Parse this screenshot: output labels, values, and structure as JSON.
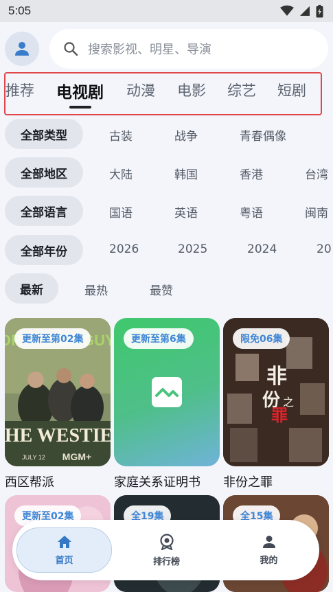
{
  "status_bar": {
    "time": "5:05"
  },
  "search": {
    "placeholder": "搜索影视、明星、导演"
  },
  "tabs": [
    {
      "label": "推荐"
    },
    {
      "label": "电视剧",
      "active": true
    },
    {
      "label": "动漫"
    },
    {
      "label": "电影"
    },
    {
      "label": "综艺"
    },
    {
      "label": "短剧"
    }
  ],
  "filters": {
    "type": {
      "label": "全部类型",
      "options": [
        "古装",
        "战争",
        "青春偶像"
      ]
    },
    "region": {
      "label": "全部地区",
      "options": [
        "大陆",
        "韩国",
        "香港",
        "台湾"
      ]
    },
    "language": {
      "label": "全部语言",
      "options": [
        "国语",
        "英语",
        "粤语",
        "闽南"
      ]
    },
    "year": {
      "label": "全部年份",
      "options": [
        "2026",
        "2025",
        "2024",
        "20"
      ]
    },
    "sort": {
      "label": "最新",
      "options": [
        "最热",
        "最赞"
      ]
    }
  },
  "cards": [
    {
      "badge": "更新至第02集",
      "title": "西区帮派",
      "poster_text": [
        "FOR THOSE GUYS",
        "THE WESTIES",
        "JULY 12",
        "MGM+"
      ]
    },
    {
      "badge": "更新至第6集",
      "title": "家庭关系证明书"
    },
    {
      "badge": "限免06集",
      "title": "非份之罪",
      "poster_text": [
        "非",
        "份",
        "之",
        "罪"
      ]
    },
    {
      "badge": "更新至02集",
      "title": ""
    },
    {
      "badge": "全19集",
      "title": ""
    },
    {
      "badge": "全15集",
      "title": ""
    }
  ],
  "bottom_nav": [
    {
      "label": "首页",
      "icon": "home-icon",
      "active": true
    },
    {
      "label": "排行榜",
      "icon": "ranking-icon"
    },
    {
      "label": "我的",
      "icon": "profile-icon"
    }
  ],
  "colors": {
    "accent": "#3f86d6",
    "highlight_box": "#e0474c",
    "background": "#f3f5fb"
  }
}
